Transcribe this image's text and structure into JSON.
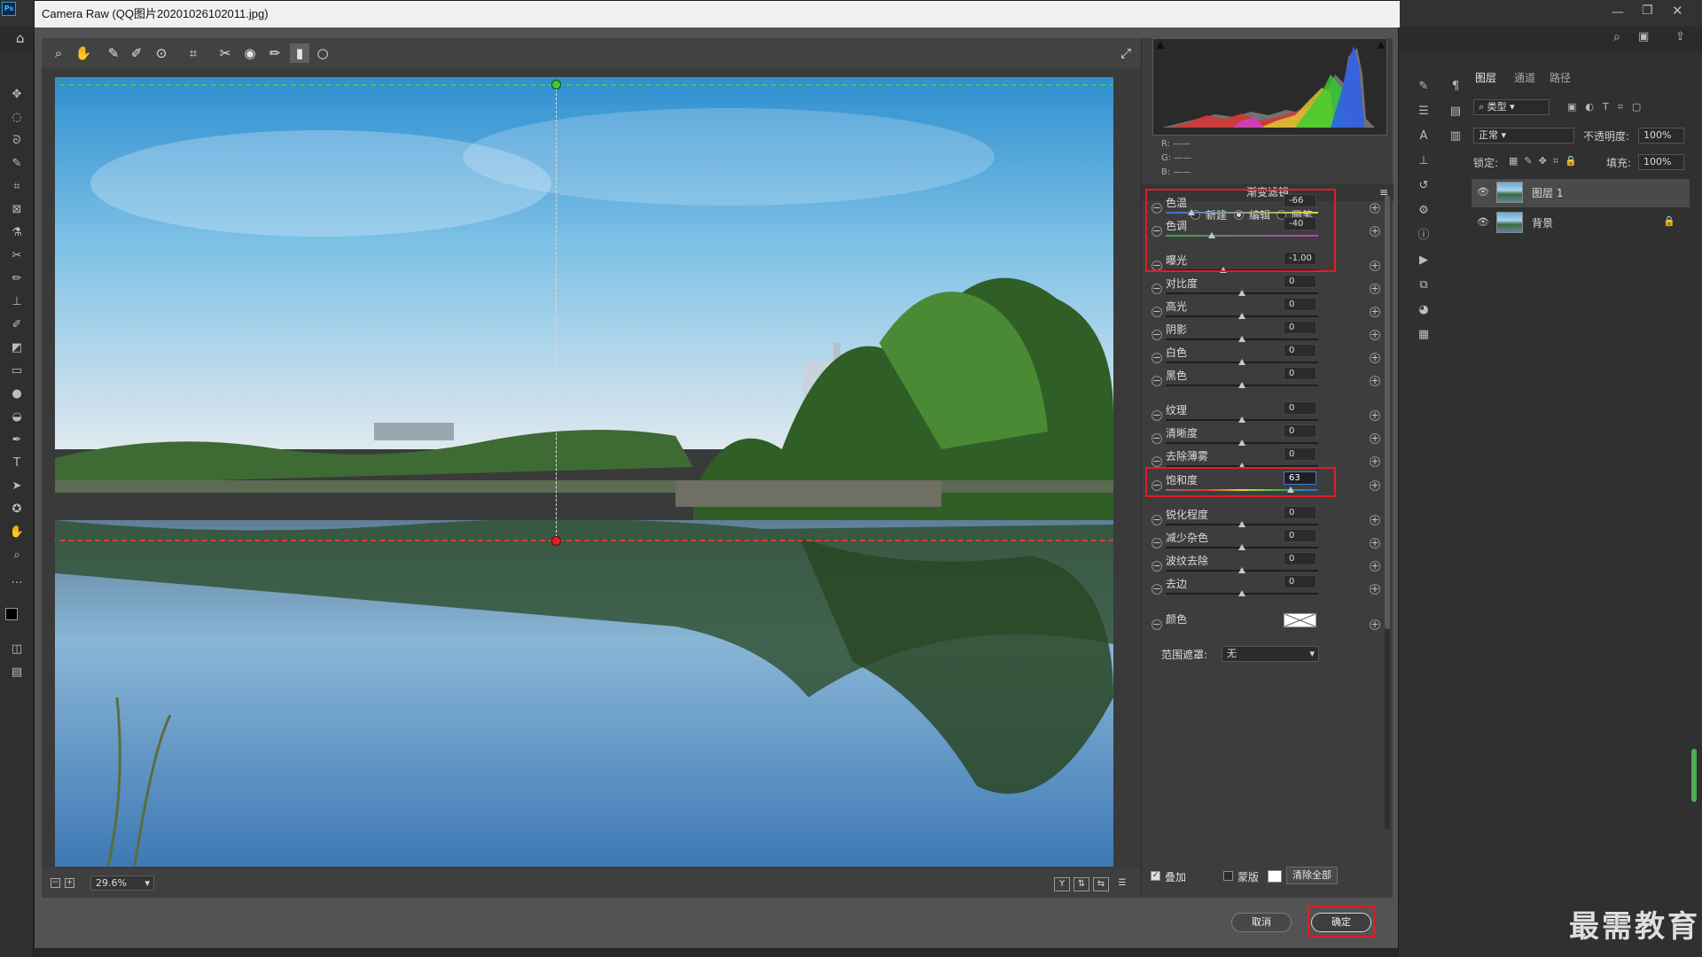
{
  "dialog": {
    "title": "Camera Raw (QQ图片20201026102011.jpg)"
  },
  "histogram": {
    "r": "R:",
    "g": "G:",
    "b": "B:",
    "r_val": "——",
    "g_val": "——",
    "b_val": "——"
  },
  "filter": {
    "title": "渐变滤镜",
    "modes": [
      "新建",
      "编辑",
      "画笔"
    ],
    "selected_mode": "编辑"
  },
  "sliders": [
    {
      "label": "色温",
      "value": "-66",
      "level": 0.17,
      "track": "temp"
    },
    {
      "label": "色调",
      "value": "-40",
      "level": 0.3,
      "track": "tint"
    },
    {
      "label": "曝光",
      "value": "-1.00",
      "level": 0.38,
      "track": "plain"
    },
    {
      "label": "对比度",
      "value": "0",
      "level": 0.5,
      "track": "plain"
    },
    {
      "label": "高光",
      "value": "0",
      "level": 0.5,
      "track": "plain"
    },
    {
      "label": "阴影",
      "value": "0",
      "level": 0.5,
      "track": "plain"
    },
    {
      "label": "白色",
      "value": "0",
      "level": 0.5,
      "track": "plain"
    },
    {
      "label": "黑色",
      "value": "0",
      "level": 0.5,
      "track": "plain"
    },
    {
      "label": "纹理",
      "value": "0",
      "level": 0.5,
      "track": "plain"
    },
    {
      "label": "清晰度",
      "value": "0",
      "level": 0.5,
      "track": "plain"
    },
    {
      "label": "去除薄雾",
      "value": "0",
      "level": 0.5,
      "track": "plain"
    },
    {
      "label": "饱和度",
      "value": "63",
      "level": 0.82,
      "track": "sat"
    },
    {
      "label": "锐化程度",
      "value": "0",
      "level": 0.5,
      "track": "plain"
    },
    {
      "label": "减少杂色",
      "value": "0",
      "level": 0.5,
      "track": "plain"
    },
    {
      "label": "波纹去除",
      "value": "0",
      "level": 0.5,
      "track": "plain"
    },
    {
      "label": "去边",
      "value": "0",
      "level": 0.5,
      "track": "plain"
    }
  ],
  "color_row": {
    "label": "颜色"
  },
  "range_mask": {
    "label": "范围遮罩:",
    "value": "无"
  },
  "bottom": {
    "overlay": "叠加",
    "mask": "蒙版",
    "clear_all": "清除全部"
  },
  "footer": {
    "zoom": "29.6%"
  },
  "buttons": {
    "cancel": "取消",
    "ok": "确定"
  },
  "layers_panel": {
    "tabs": [
      "图层",
      "通道",
      "路径"
    ],
    "filter": "类型",
    "blend": "正常",
    "opacity_label": "不透明度:",
    "opacity": "100%",
    "lock_label": "锁定:",
    "fill_label": "填充:",
    "fill": "100%",
    "layers": [
      "图层 1",
      "背景"
    ]
  },
  "watermark": "最需教育"
}
